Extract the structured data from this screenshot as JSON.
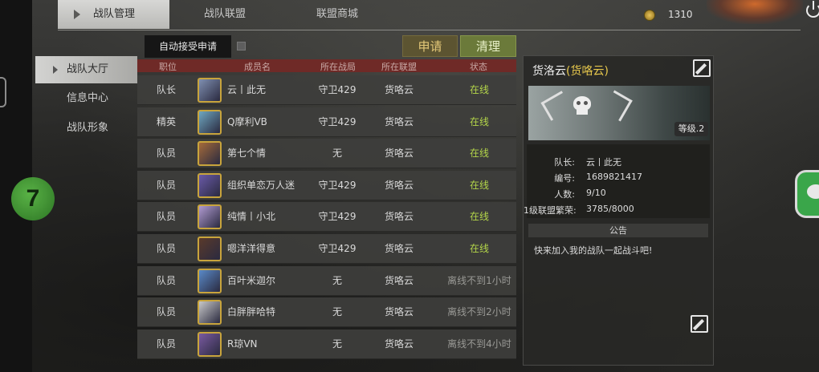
{
  "top_tabs": [
    {
      "label": "战队管理",
      "active": true
    },
    {
      "label": "战队联盟",
      "active": false
    },
    {
      "label": "联盟商城",
      "active": false
    }
  ],
  "currency": {
    "icon": "coin-icon",
    "value": "1310"
  },
  "side_nav": [
    {
      "label": "战队大厅",
      "active": true
    },
    {
      "label": "信息中心",
      "active": false
    },
    {
      "label": "战队形象",
      "active": false
    }
  ],
  "controls": {
    "auto_accept_label": "自动接受申请",
    "auto_accept_checked": false,
    "apply_label": "申请",
    "clear_label": "清理"
  },
  "table": {
    "headers": [
      "职位",
      "成员名",
      "所在战局",
      "所在联盟",
      "状态"
    ],
    "rows": [
      {
        "role": "队长",
        "name": "云丨此无",
        "battle": "守卫429",
        "alliance": "货咯云",
        "status": "在线",
        "online": true,
        "avatar_color": "#7f8fb0"
      },
      {
        "role": "精英",
        "name": "Q摩利VB",
        "battle": "守卫429",
        "alliance": "货咯云",
        "status": "在线",
        "online": true,
        "avatar_color": "#6fa7c0"
      },
      {
        "role": "队员",
        "name": "第七个情",
        "battle": "无",
        "alliance": "货咯云",
        "status": "在线",
        "online": true,
        "avatar_color": "#a46a3a"
      },
      {
        "role": "队员",
        "name": "组织单恋万人迷",
        "battle": "守卫429",
        "alliance": "货咯云",
        "status": "在线",
        "online": true,
        "avatar_color": "#6a5aa8"
      },
      {
        "role": "队员",
        "name": "纯情丨小北",
        "battle": "守卫429",
        "alliance": "货咯云",
        "status": "在线",
        "online": true,
        "avatar_color": "#b09ad0"
      },
      {
        "role": "队员",
        "name": "嗯洋洋得意",
        "battle": "守卫429",
        "alliance": "货咯云",
        "status": "在线",
        "online": true,
        "avatar_color": "#5a3a2a"
      },
      {
        "role": "队员",
        "name": "百叶米迦尔",
        "battle": "无",
        "alliance": "货咯云",
        "status": "离线不到1小时",
        "online": false,
        "avatar_color": "#5a8ac8"
      },
      {
        "role": "队员",
        "name": "白胖胖哈特",
        "battle": "无",
        "alliance": "货咯云",
        "status": "离线不到2小时",
        "online": false,
        "avatar_color": "#c8c8c8"
      },
      {
        "role": "队员",
        "name": "R琼VN",
        "battle": "无",
        "alliance": "货咯云",
        "status": "离线不到4小时",
        "online": false,
        "avatar_color": "#7a5aa0"
      }
    ]
  },
  "team": {
    "name": "货洛云",
    "alliance_paren": "(货咯云)",
    "level_badge": "等级.2",
    "info": [
      {
        "key": "队长:",
        "value": "云丨此无"
      },
      {
        "key": "编号:",
        "value": "1689821417"
      },
      {
        "key": "人数:",
        "value": "9/10"
      },
      {
        "key": "1级联盟繁荣:",
        "value": "3785/8000"
      }
    ],
    "notice_title": "公告",
    "notice_text": "快来加入我的战队一起战斗吧!"
  }
}
